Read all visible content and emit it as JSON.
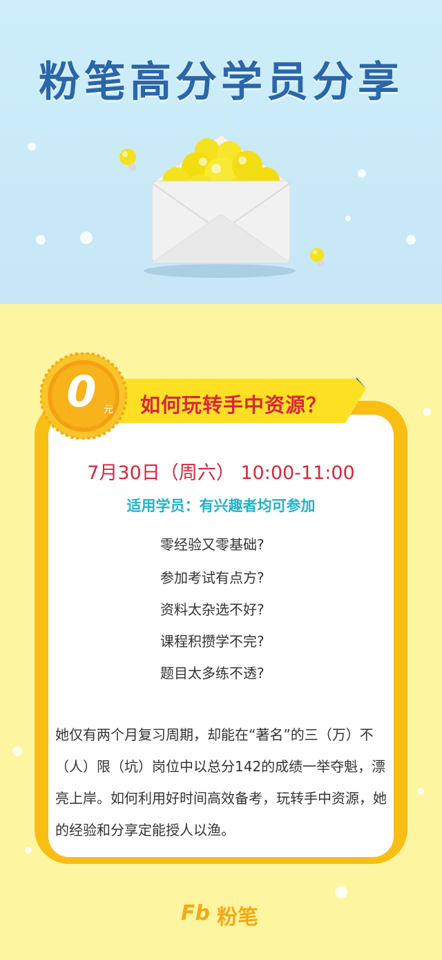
{
  "headline": "粉笔高分学员分享",
  "coin": {
    "value": "0",
    "unit": "元"
  },
  "banner": {
    "title": "如何玩转手中资源？"
  },
  "event": {
    "date_time": "7月30日（周六） 10:00-11:00",
    "audience": "适用学员：有兴趣者均可参加"
  },
  "questions": [
    "零经验又零基础?",
    "参加考试有点方?",
    "资料太杂选不好?",
    "课程积攒学不完?",
    "题目太多练不透?"
  ],
  "description": "她仅有两个月复习周期，却能在“著名”的三（万）不（人）限（坑）岗位中以总分142的成绩一举夺魁，漂亮上岸。如何利用好时间高效备考，玩转手中资源，她的经验和分享定能授人以渔。",
  "brand": {
    "mark": "Fb",
    "name": "粉笔"
  },
  "colors": {
    "accent_red": "#d9263b",
    "teal": "#22b2c9",
    "brand_orange": "#f4a914",
    "frame_yellow": "#f9be14"
  }
}
